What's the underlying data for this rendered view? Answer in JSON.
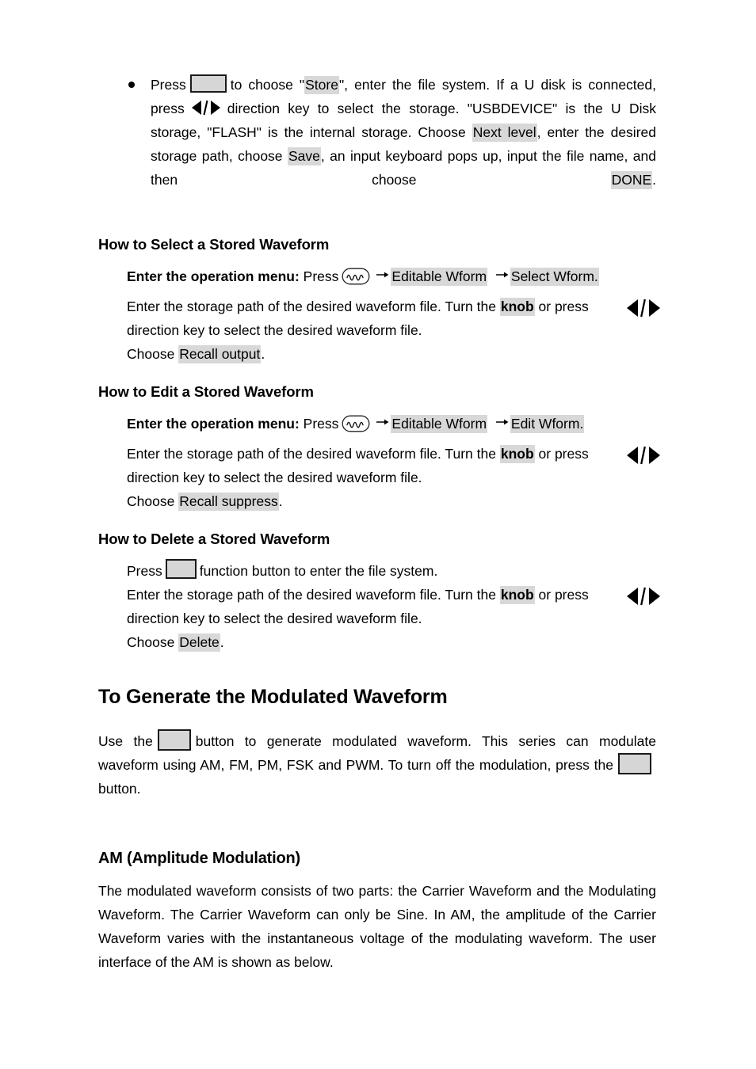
{
  "document": {
    "bullet_item": {
      "bullet_glyph": "•",
      "seg1": "Press",
      "key1": "store-key",
      "seg2": "to choose \"",
      "hl1": "Store",
      "seg3": "\", enter the file system. If a U disk is connected, press",
      "direction_keys": "left-right-direction-keys",
      "seg4": "direction key to select the storage. \"USBDEVICE\" is the U Disk storage, \"FLASH\" is the internal storage. Choose",
      "hl2": "Next level",
      "seg5": ", enter the desired storage path, choose",
      "hl3": "Save",
      "seg6": ", an input keyboard pops up, input the file name, and then choose",
      "hl4": "DONE",
      "seg7": "."
    },
    "section_select": {
      "heading": "How to Select a Stored Waveform",
      "menu_label": "Enter the operation menu:",
      "menu_press": "Press",
      "wave_icon": "arb-waveform-key-icon",
      "arrow_glyph": "→",
      "menu_item_1": "Editable Wform",
      "menu_item_2": "Select Wform.",
      "body_1": "Enter the storage path of the desired waveform file. Turn the",
      "body_knob": "knob",
      "body_2": "or press",
      "body_3": "direction key to select the desired waveform file.",
      "choose_label": "Choose",
      "choose_value": "Recall output",
      "choose_period": "."
    },
    "section_edit": {
      "heading": "How to Edit a Stored Waveform",
      "menu_label": "Enter the operation menu:",
      "menu_press": "Press",
      "wave_icon": "arb-waveform-key-icon",
      "menu_item_1": "Editable Wform",
      "menu_item_2": "Edit Wform.",
      "body_1": "Enter the storage path of the desired waveform file. Turn the",
      "body_knob": "knob",
      "body_2": "or press",
      "body_3": "direction key to select the desired waveform file.",
      "choose_label": "Choose",
      "choose_value": "Recall suppress",
      "choose_period": "."
    },
    "section_delete": {
      "heading": "How to Delete a Stored Waveform",
      "press_label": "Press",
      "key": "file-function-key",
      "press_rest": "function button to enter the file system.",
      "body_1": "Enter the storage path of the desired waveform file. Turn the",
      "body_knob": "knob",
      "body_2": "or press",
      "body_3": "direction key to select the desired waveform file.",
      "choose_label": "Choose",
      "choose_value": "Delete",
      "choose_period": "."
    },
    "section_modulation": {
      "heading": "To Generate the Modulated Waveform",
      "p1_seg1": "Use the",
      "p1_key1": "mod-button",
      "p1_seg2": "button to generate modulated waveform. This series can modulate waveform using AM, FM, PM, FSK and PWM. To turn off the modulation, press the",
      "p1_key2": "mod-off-button",
      "p1_seg3": "button."
    },
    "section_am": {
      "heading": "AM (Amplitude Modulation)",
      "paragraph": "The modulated waveform consists of two parts: the Carrier Waveform and the Modulating Waveform. The Carrier Waveform can only be Sine. In AM, the amplitude of the Carrier Waveform varies with the instantaneous voltage of the modulating waveform. The user interface of the AM is shown as below."
    }
  },
  "colors": {
    "highlight": "#d8d8d8",
    "keybox_fill": "#d6d6d6",
    "keybox_border": "#1a1a1a",
    "text": "#000000",
    "background": "#ffffff"
  }
}
